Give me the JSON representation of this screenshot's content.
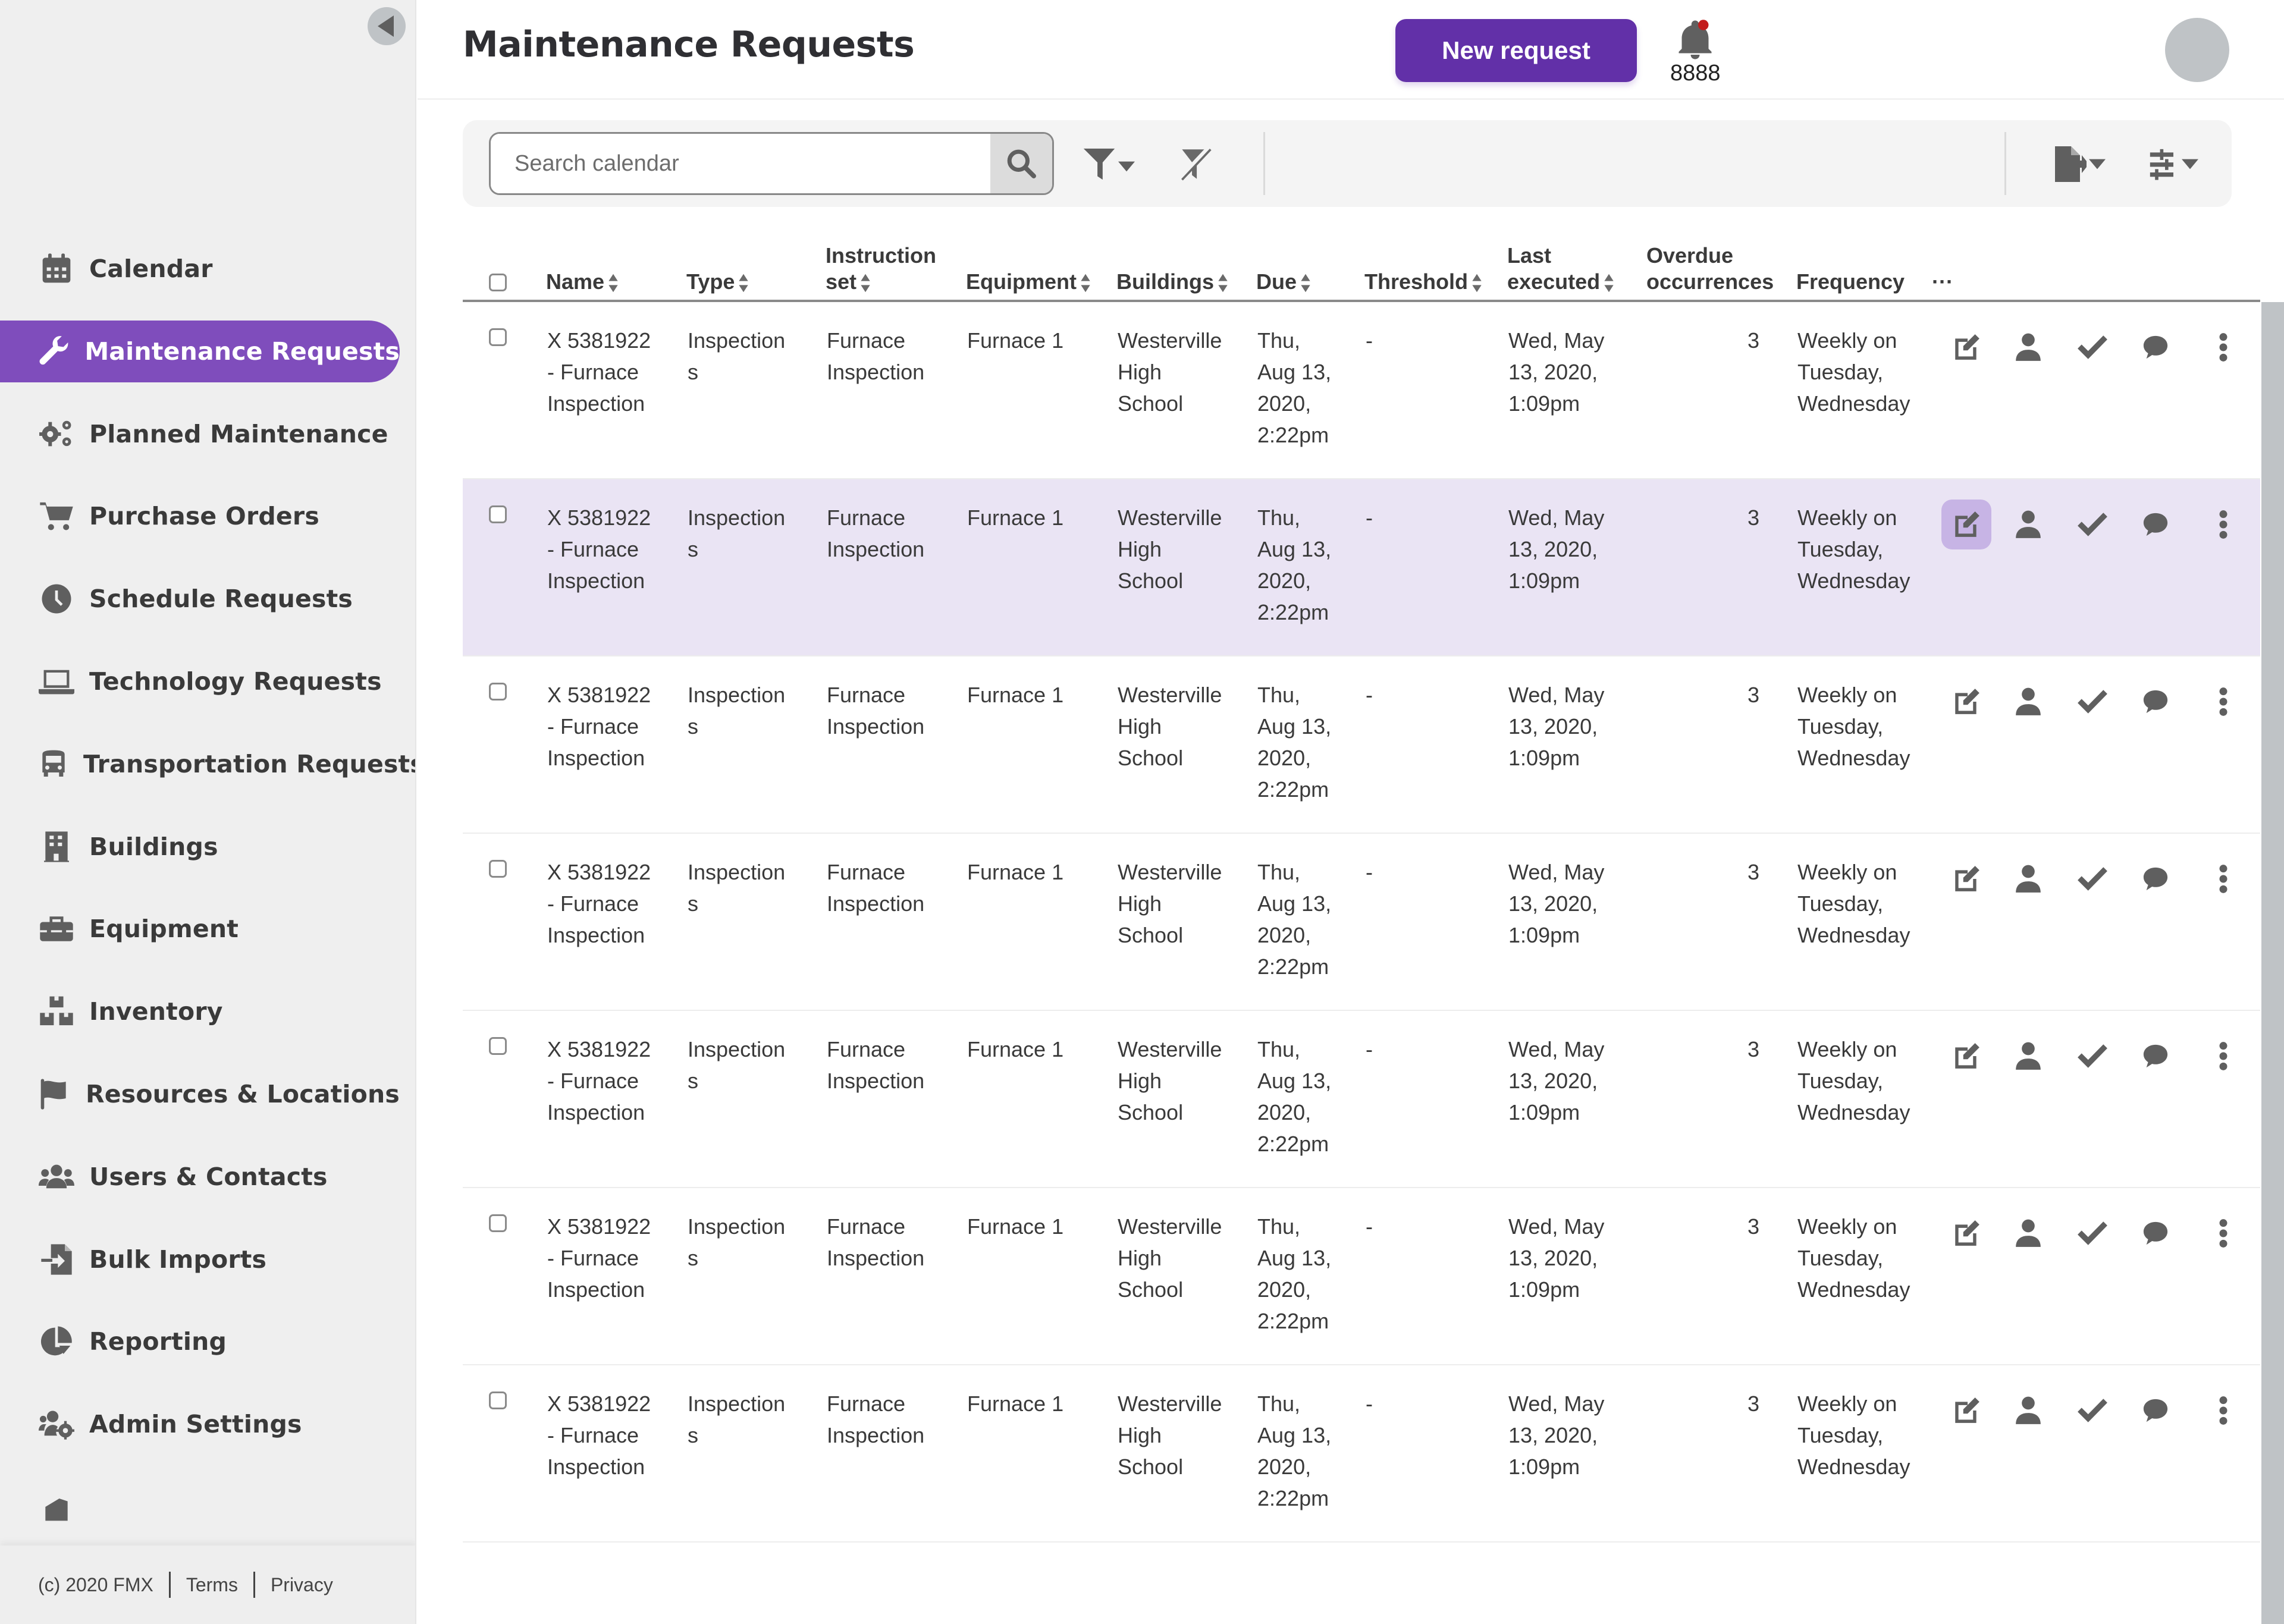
{
  "sidebar": {
    "collapse_label": "Collapse sidebar",
    "items": [
      {
        "label": "Calendar",
        "icon": "calendar-icon"
      },
      {
        "label": "Maintenance Requests",
        "icon": "wrench-icon",
        "active": true
      },
      {
        "label": "Planned Maintenance",
        "icon": "gears-icon"
      },
      {
        "label": "Purchase Orders",
        "icon": "cart-icon"
      },
      {
        "label": "Schedule Requests",
        "icon": "clock-icon"
      },
      {
        "label": "Technology Requests",
        "icon": "laptop-icon"
      },
      {
        "label": "Transportation Requests",
        "icon": "bus-icon"
      },
      {
        "label": "Buildings",
        "icon": "building-icon"
      },
      {
        "label": "Equipment",
        "icon": "toolbox-icon"
      },
      {
        "label": "Inventory",
        "icon": "boxes-icon"
      },
      {
        "label": "Resources & Locations",
        "icon": "flag-icon"
      },
      {
        "label": "Users & Contacts",
        "icon": "users-icon"
      },
      {
        "label": "Bulk Imports",
        "icon": "file-import-icon"
      },
      {
        "label": "Reporting",
        "icon": "pie-chart-icon"
      },
      {
        "label": "Admin Settings",
        "icon": "users-cog-icon"
      }
    ],
    "footer": {
      "copyright": "(c) 2020 FMX",
      "terms": "Terms",
      "privacy": "Privacy"
    }
  },
  "header": {
    "title": "Maintenance Requests",
    "new_request_label": "New request",
    "notification_count": "8888",
    "accent_color": "#6230a8"
  },
  "toolbar": {
    "search_placeholder": "Search calendar",
    "search_value": ""
  },
  "table": {
    "columns": [
      {
        "key": "name",
        "label": "Name",
        "sortable": true
      },
      {
        "key": "type",
        "label": "Type",
        "sortable": true
      },
      {
        "key": "instruction_set",
        "label_line1": "Instruction",
        "label_line2": "set",
        "sortable": true
      },
      {
        "key": "equipment",
        "label": "Equipment",
        "sortable": true
      },
      {
        "key": "buildings",
        "label": "Buildings",
        "sortable": true
      },
      {
        "key": "due",
        "label": "Due",
        "sortable": true
      },
      {
        "key": "threshold",
        "label": "Threshold",
        "sortable": true
      },
      {
        "key": "last_executed",
        "label_line1": "Last",
        "label_line2": "executed",
        "sortable": true
      },
      {
        "key": "overdue",
        "label_line1": "Overdue",
        "label_line2": "occurrences",
        "sortable": false
      },
      {
        "key": "frequency",
        "label": "Frequency",
        "sortable": false
      },
      {
        "key": "more",
        "label": "···",
        "sortable": false
      }
    ],
    "rows": [
      {
        "name": [
          "X 5381922",
          "- Furnace",
          "Inspection"
        ],
        "type": [
          "Inspection",
          "s"
        ],
        "instruction_set": [
          "Furnace",
          "Inspection"
        ],
        "equipment": "Furnace 1",
        "buildings": [
          "Westerville",
          "High",
          "School"
        ],
        "due": [
          "Thu,",
          "Aug 13,",
          "2020,",
          "2:22pm"
        ],
        "threshold": "-",
        "last_executed": [
          "Wed, May",
          "13, 2020,",
          "1:09pm"
        ],
        "overdue": "3",
        "frequency": [
          "Weekly on",
          "Tuesday,",
          "Wednesday"
        ],
        "highlighted": false
      },
      {
        "name": [
          "X 5381922",
          "- Furnace",
          "Inspection"
        ],
        "type": [
          "Inspection",
          "s"
        ],
        "instruction_set": [
          "Furnace",
          "Inspection"
        ],
        "equipment": "Furnace 1",
        "buildings": [
          "Westerville",
          "High",
          "School"
        ],
        "due": [
          "Thu,",
          "Aug 13,",
          "2020,",
          "2:22pm"
        ],
        "threshold": "-",
        "last_executed": [
          "Wed, May",
          "13, 2020,",
          "1:09pm"
        ],
        "overdue": "3",
        "frequency": [
          "Weekly on",
          "Tuesday,",
          "Wednesday"
        ],
        "highlighted": true
      },
      {
        "name": [
          "X 5381922",
          "- Furnace",
          "Inspection"
        ],
        "type": [
          "Inspection",
          "s"
        ],
        "instruction_set": [
          "Furnace",
          "Inspection"
        ],
        "equipment": "Furnace 1",
        "buildings": [
          "Westerville",
          "High",
          "School"
        ],
        "due": [
          "Thu,",
          "Aug 13,",
          "2020,",
          "2:22pm"
        ],
        "threshold": "-",
        "last_executed": [
          "Wed, May",
          "13, 2020,",
          "1:09pm"
        ],
        "overdue": "3",
        "frequency": [
          "Weekly on",
          "Tuesday,",
          "Wednesday"
        ],
        "highlighted": false
      },
      {
        "name": [
          "X 5381922",
          "- Furnace",
          "Inspection"
        ],
        "type": [
          "Inspection",
          "s"
        ],
        "instruction_set": [
          "Furnace",
          "Inspection"
        ],
        "equipment": "Furnace 1",
        "buildings": [
          "Westerville",
          "High",
          "School"
        ],
        "due": [
          "Thu,",
          "Aug 13,",
          "2020,",
          "2:22pm"
        ],
        "threshold": "-",
        "last_executed": [
          "Wed, May",
          "13, 2020,",
          "1:09pm"
        ],
        "overdue": "3",
        "frequency": [
          "Weekly on",
          "Tuesday,",
          "Wednesday"
        ],
        "highlighted": false
      },
      {
        "name": [
          "X 5381922",
          "- Furnace",
          "Inspection"
        ],
        "type": [
          "Inspection",
          "s"
        ],
        "instruction_set": [
          "Furnace",
          "Inspection"
        ],
        "equipment": "Furnace 1",
        "buildings": [
          "Westerville",
          "High",
          "School"
        ],
        "due": [
          "Thu,",
          "Aug 13,",
          "2020,",
          "2:22pm"
        ],
        "threshold": "-",
        "last_executed": [
          "Wed, May",
          "13, 2020,",
          "1:09pm"
        ],
        "overdue": "3",
        "frequency": [
          "Weekly on",
          "Tuesday,",
          "Wednesday"
        ],
        "highlighted": false
      },
      {
        "name": [
          "X 5381922",
          "- Furnace",
          "Inspection"
        ],
        "type": [
          "Inspection",
          "s"
        ],
        "instruction_set": [
          "Furnace",
          "Inspection"
        ],
        "equipment": "Furnace 1",
        "buildings": [
          "Westerville",
          "High",
          "School"
        ],
        "due": [
          "Thu,",
          "Aug 13,",
          "2020,",
          "2:22pm"
        ],
        "threshold": "-",
        "last_executed": [
          "Wed, May",
          "13, 2020,",
          "1:09pm"
        ],
        "overdue": "3",
        "frequency": [
          "Weekly on",
          "Tuesday,",
          "Wednesday"
        ],
        "highlighted": false
      },
      {
        "name": [
          "X 5381922",
          "- Furnace",
          "Inspection"
        ],
        "type": [
          "Inspection",
          "s"
        ],
        "instruction_set": [
          "Furnace",
          "Inspection"
        ],
        "equipment": "Furnace 1",
        "buildings": [
          "Westerville",
          "High",
          "School"
        ],
        "due": [
          "Thu,",
          "Aug 13,",
          "2020,",
          "2:22pm"
        ],
        "threshold": "-",
        "last_executed": [
          "Wed, May",
          "13, 2020,",
          "1:09pm"
        ],
        "overdue": "3",
        "frequency": [
          "Weekly on",
          "Tuesday,",
          "Wednesday"
        ],
        "highlighted": false
      }
    ],
    "row_actions": [
      {
        "icon": "edit-icon",
        "label": "Edit"
      },
      {
        "icon": "person-icon",
        "label": "Assign"
      },
      {
        "icon": "checkmark-icon",
        "label": "Complete"
      },
      {
        "icon": "comment-icon",
        "label": "Comment"
      },
      {
        "icon": "more-vertical-icon",
        "label": "More"
      }
    ],
    "highlight_color": "#eae4f4"
  }
}
